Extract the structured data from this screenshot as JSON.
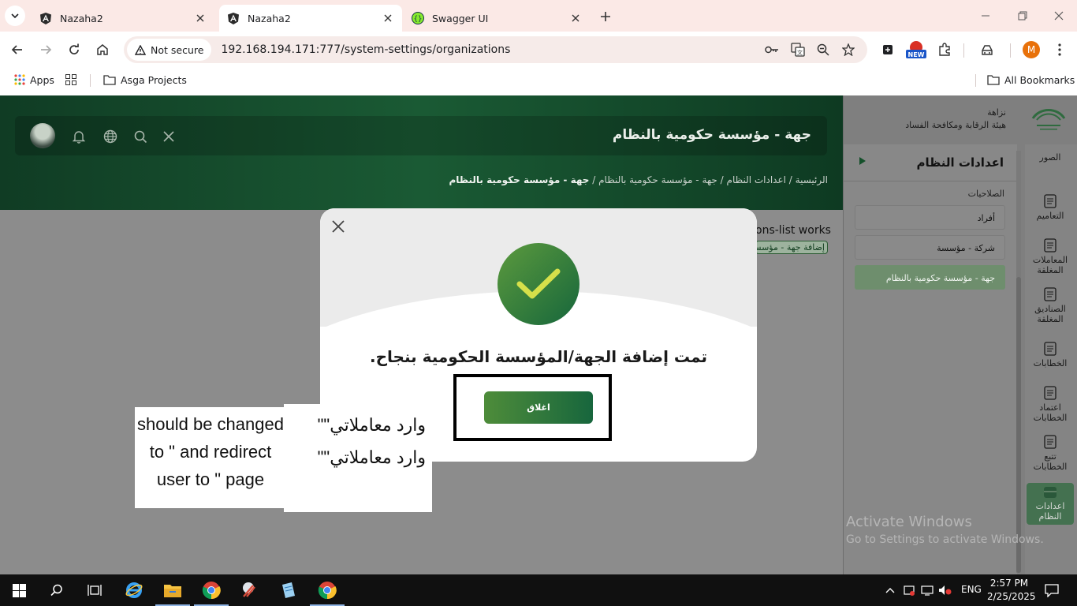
{
  "browser": {
    "tabs": [
      {
        "title": "Nazaha2",
        "active": false
      },
      {
        "title": "Nazaha2",
        "active": true
      },
      {
        "title": "Swagger UI",
        "active": false
      }
    ],
    "security_label": "Not secure",
    "url": "192.168.194.171:777/system-settings/organizations",
    "profile_initial": "M",
    "bookmarks": {
      "apps": "Apps",
      "folder": "Asga Projects",
      "all": "All Bookmarks"
    },
    "ext_badge": "NEW"
  },
  "page": {
    "header_title": "جهة - مؤسسة حكومية بالنظام",
    "breadcrumb": {
      "home": "الرئيسية",
      "settings": "اعدادات النظام",
      "parent": "جهة - مؤسسة حكومية بالنظام",
      "current": "جهة - مؤسسة حكومية بالنظام"
    },
    "behind_text": "ons-list works",
    "behind_link": "إضافة جهة - مؤسسة"
  },
  "sidebar": {
    "brand_line1": "نزاهة",
    "brand_line2": "هيئة الرقابة ومكافحة الفساد",
    "panel_title": "اعدادات النظام",
    "permissions_label": "الصلاحيات",
    "permissions": [
      "أفراد",
      "شركة - مؤسسة",
      "جهة - مؤسسة حكومية بالنظام"
    ],
    "rail": [
      "الصور",
      "التعاميم",
      "المعاملات المغلقة",
      "الصناديق المغلقة",
      "الخطابات",
      "اعتماد الخطابات",
      "تتبع الخطابات",
      "اعدادات النظام"
    ]
  },
  "modal": {
    "message": "تمت إضافة الجهة/المؤسسة الحكومية بنجاح.",
    "close_button": "اغلاق"
  },
  "annotation": {
    "english_text": "should be changed to \" and redirect user to \" page",
    "arabic_line1": "وارد معاملاتي\"\"",
    "arabic_line2": "وارد معاملاتي\"\""
  },
  "watermark": {
    "line1": "Activate Windows",
    "line2": "Go to Settings to activate Windows."
  },
  "taskbar": {
    "lang": "ENG",
    "time": "2:57 PM",
    "date": "2/25/2025"
  },
  "colors": {
    "brand_green": "#17663d",
    "accent_green": "#5c9a3d",
    "overlay_gray": "#8c8c8c"
  }
}
